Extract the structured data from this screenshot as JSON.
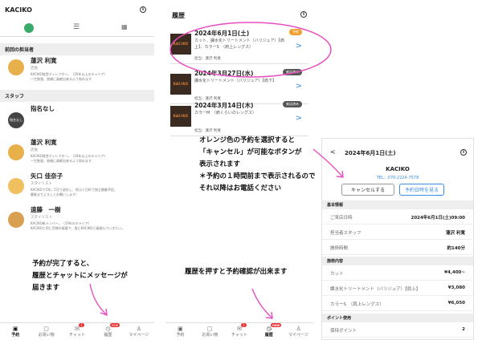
{
  "s1": {
    "title": "KACIKO",
    "info": "i",
    "sec_prev": "前回の担当者",
    "sec_staff": "スタッフ",
    "staff": [
      {
        "name": "蓮沢 利寛",
        "role": "店長",
        "desc": "KACIKO経営ディレクター。（20年以上のキャリア）\n一生勉強、皆様に貢献出来るよう努めます"
      },
      {
        "name": "指名なし",
        "role": "",
        "desc": ""
      },
      {
        "name": "蓮沢 利寛",
        "role": "店長",
        "desc": "KACIKO経営ディレクター。（20年以上のキャリア）\n一生勉強、皆様に貢献出来るよう努めます"
      },
      {
        "name": "矢口 佳奈子",
        "role": "スタイリスト",
        "desc": "KACIKOで5年。5月で退社し、地元十日町で独立開業予定。\n最後までよろしくお願いします！"
      },
      {
        "name": "遠藤　一樹",
        "role": "スタイリスト",
        "desc": "KACIKO新メンバー。（19年のキャリア）\nKACIKOと同じ目線の接客で、皆にKACIKOに貢献んでいきたい。"
      }
    ],
    "no_pref_avatar": "指名なし",
    "annotation": "予約が完了すると、\n履歴とチャットにメッセージが\n届きます",
    "nav": [
      "予約",
      "お買い物",
      "チャット",
      "履歴",
      "マイページ"
    ],
    "nav_icons": [
      "▣",
      "▢",
      "✉",
      "◷",
      "♙"
    ],
    "badge_chat": "1",
    "badge_hist": "new"
  },
  "s2": {
    "title": "履歴",
    "info": "i",
    "cards": [
      {
        "date": "2024年6月1日(土)",
        "menu": "カット、課水化トリートメント（バリジュア）【肩上】、カラーS　（肩上レングス）",
        "staff": "担当：蓮沢 利寛",
        "tag": "予約"
      },
      {
        "date": "2024年3月27日(水)",
        "menu": "課水化トリートメント（バリジュア）【肩下】",
        "staff": "担当：蓮沢 利寛",
        "tag": "来店済み"
      },
      {
        "date": "2024年3月14日(木)",
        "menu": "カラーM　（肩くらいのレングス）",
        "staff": "担当：蓮沢 利寛",
        "tag": "来店済み"
      }
    ],
    "thumb_text": "KACIKO",
    "chevron": ">",
    "annotation1": "オレンジ色の予約を選択すると\n「キャンセル」が可能なボタンが\n表示されます\n＊予約の１時間前まで表示されるので\nそれ以降はお電話ください",
    "annotation2": "履歴を押すと予約確認が出来ます",
    "nav": [
      "予約",
      "お買い物",
      "チャット",
      "履歴",
      "マイページ"
    ],
    "nav_icons": [
      "▣",
      "▢",
      "✉",
      "◷",
      "♙"
    ],
    "badge_chat": "1",
    "badge_hist": "new"
  },
  "s3": {
    "back": "<",
    "title": "2024年6月1日(土)",
    "info": "i",
    "shop": "KACIKO",
    "tel": "TEL：070-2224-7578",
    "cancel_btn": "キャンセルする",
    "view_btn": "予約日時を見る",
    "sec_basic": "基本情報",
    "rows_basic": [
      {
        "k": "ご来店日時",
        "v": "2024年6月1日(土)09:00"
      },
      {
        "k": "担当者スタッフ",
        "v": "蓮沢 利寛"
      },
      {
        "k": "施術時間",
        "v": "約140分"
      }
    ],
    "sec_menu": "施術内容",
    "rows_menu": [
      {
        "k": "カット",
        "v": "¥4,400~"
      },
      {
        "k": "課水化トリートメント（バリジュア）【肩上】",
        "v": "¥3,080"
      },
      {
        "k": "カラーS　（肩上レングス）",
        "v": "¥6,050"
      }
    ],
    "sec_point": "ポイント使用",
    "row_point": {
      "k": "保持ポイント",
      "v": "2"
    }
  },
  "colors": {
    "accent": "#3a8ee6",
    "highlight": "#e94ec0",
    "arrow": "#e94ec0",
    "orange": "#f0a030"
  }
}
